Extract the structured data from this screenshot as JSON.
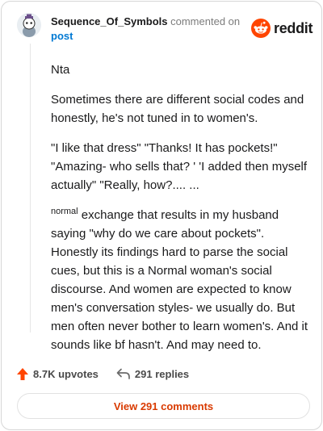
{
  "header": {
    "username": "Sequence_Of_Symbols",
    "action": "commented on",
    "target": "post",
    "brand": "reddit"
  },
  "comment": {
    "p1": "Nta",
    "p2": "Sometimes there are different social codes and honestly, he's not tuned in to women's.",
    "p3": "\"I like that dress\" \"Thanks! It has pockets!\" \"Amazing- who sells that? ' 'I added then myself actually\" \"Really, how?.... ...",
    "p4_sup": "normal",
    "p4_text": " exchange that results in my husband saying \"why do we care about pockets\". Honestly its findings hard to parse the social cues, but this is a Normal woman's social discourse. And women are expected to know men's conversation styles- we usually do. But men often never bother to learn women's. And it sounds like bf hasn't. And may need to."
  },
  "stats": {
    "upvotes": "8.7K upvotes",
    "replies": "291 replies"
  },
  "footer": {
    "view_comments": "View 291 comments"
  },
  "colors": {
    "brand_orange": "#ff4500",
    "link_blue": "#0079d3",
    "button_text": "#d93a00"
  }
}
